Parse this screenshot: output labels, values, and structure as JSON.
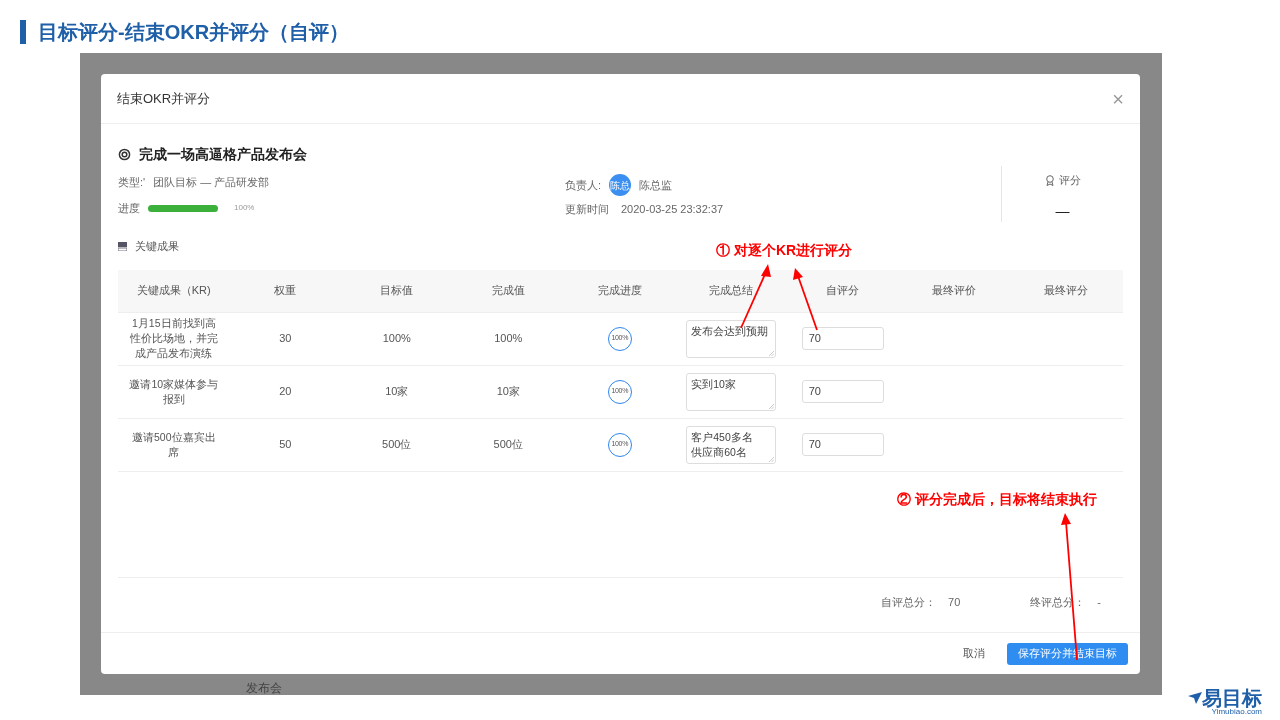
{
  "slide": {
    "title": "目标评分-结束OKR并评分（自评）",
    "logo": {
      "mark": "易目标",
      "site": "Yimubiao.com"
    }
  },
  "backdrop": {
    "partial_text": "发布会"
  },
  "dialog": {
    "title": "结束OKR并评分",
    "close": "×",
    "objective": {
      "title": "完成一场高逼格产品发布会",
      "type_label": "类型:'",
      "type_value": "团队目标 — 产品研发部",
      "progress_label": "进度",
      "progress": {
        "level": 1,
        "reading": "100%"
      },
      "owner_label": "负责人:",
      "owner_avatar": "陈总",
      "owner_name": "陈总监",
      "updated_label": "更新时间",
      "updated_value": "2020-03-25 23:32:37",
      "score_label": "评分",
      "score_value": "—"
    },
    "section_title": "关键成果",
    "table": {
      "columns": [
        "关键成果（KR)",
        "权重",
        "目标值",
        "完成值",
        "完成进度",
        "完成总结",
        "自评分",
        "最终评价",
        "最终评分"
      ],
      "rows": [
        {
          "kr": "1月15日前找到高性价比场地，并完成产品发布演练",
          "weight": "30",
          "target": "100%",
          "done": "100%",
          "progress": "100%",
          "summary": [
            "发布会达到预期"
          ],
          "self_score": "70"
        },
        {
          "kr": "邀请10家媒体参与报到",
          "weight": "20",
          "target": "10家",
          "done": "10家",
          "progress": "100%",
          "summary": [
            "实到10家"
          ],
          "self_score": "70"
        },
        {
          "kr": "邀请500位嘉宾出席",
          "weight": "50",
          "target": "500位",
          "done": "500位",
          "progress": "100%",
          "summary": [
            "客户450多名",
            "供应商60名"
          ],
          "self_score": "70"
        }
      ]
    },
    "totals": [
      {
        "label": "自评总分：",
        "value": "70"
      },
      {
        "label": "终评总分：",
        "value": "-"
      }
    ],
    "buttons": [
      {
        "label": "取消",
        "kind": "text"
      },
      {
        "label": "保存评分并结束目标",
        "kind": "primary"
      }
    ]
  },
  "annotations": [
    {
      "text": "① 对逐个KR进行评分"
    },
    {
      "text": "② 评分完成后，目标将结束执行"
    }
  ]
}
